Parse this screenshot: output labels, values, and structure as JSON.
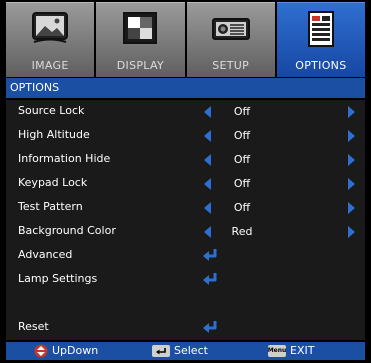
{
  "tabs": [
    {
      "label": "IMAGE",
      "icon": "image-icon"
    },
    {
      "label": "DISPLAY",
      "icon": "display-icon"
    },
    {
      "label": "SETUP",
      "icon": "projector-icon"
    },
    {
      "label": "OPTIONS",
      "icon": "options-icon"
    }
  ],
  "active_tab": "OPTIONS",
  "section_title": "OPTIONS",
  "options": [
    {
      "label": "Source Lock",
      "value": "Off"
    },
    {
      "label": "High Altitude",
      "value": "Off"
    },
    {
      "label": "Information Hide",
      "value": "Off"
    },
    {
      "label": "Keypad Lock",
      "value": "Off"
    },
    {
      "label": "Test Pattern",
      "value": "Off"
    },
    {
      "label": "Background Color",
      "value": "Red"
    },
    {
      "label": "Advanced",
      "value": ""
    },
    {
      "label": "Lamp Settings",
      "value": ""
    },
    {
      "label": "Reset",
      "value": ""
    }
  ],
  "footer": {
    "updown": "UpDown",
    "select": "Select",
    "menu_key": "Menu",
    "exit": "EXIT"
  },
  "colors": {
    "accent": "#2f6fd0",
    "titlebar": "#1b4fa3",
    "panel": "#1a1a1a",
    "tab_inactive": "#7a7a7a"
  }
}
